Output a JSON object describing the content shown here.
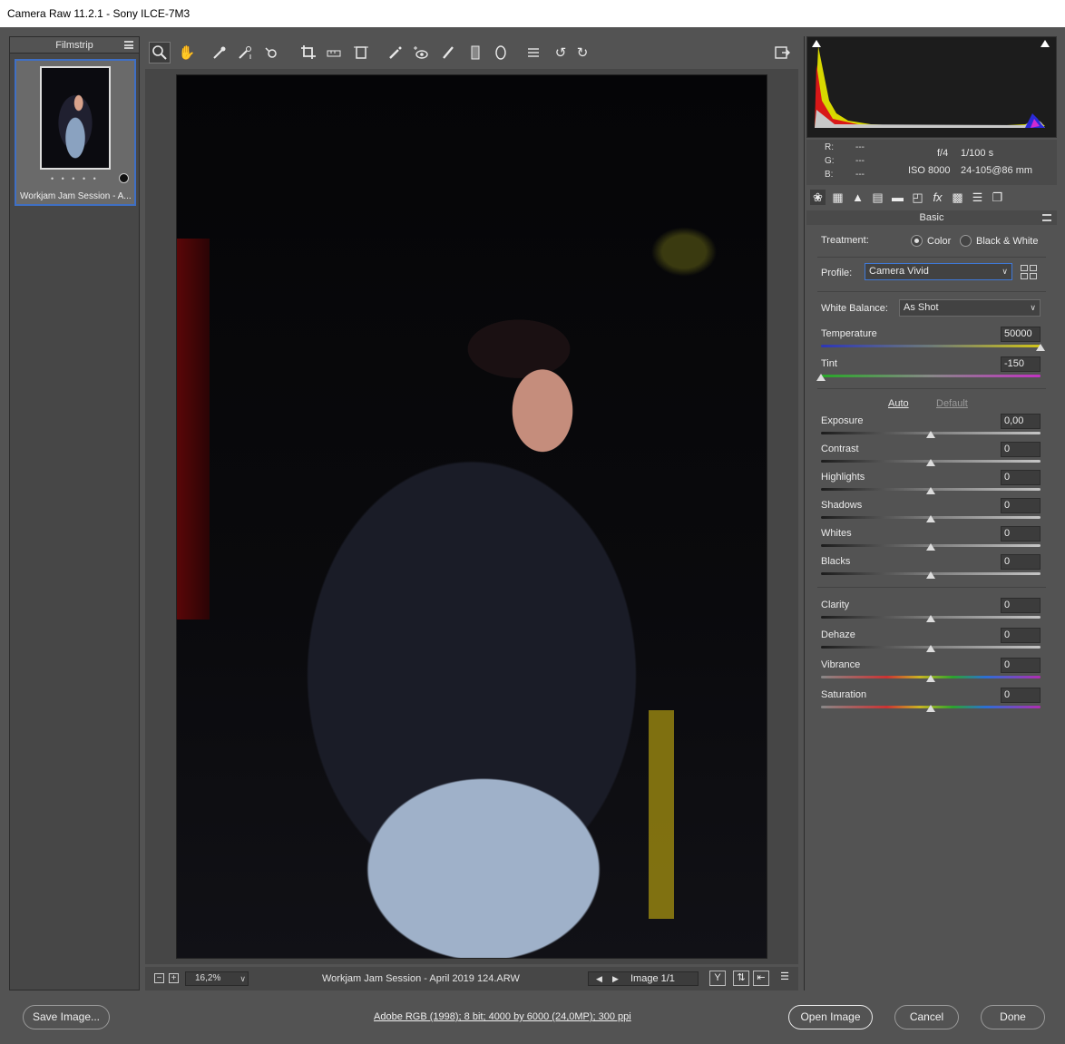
{
  "window": {
    "title": "Camera Raw 11.2.1  -  Sony ILCE-7M3"
  },
  "filmstrip": {
    "title": "Filmstrip",
    "thumbnail_caption": "Workjam Jam Session - A...",
    "rating_dots": "• • • • •"
  },
  "toolbar": {
    "tools": [
      "zoom-tool",
      "hand-tool",
      "white-balance-tool",
      "color-sampler-tool",
      "targeted-adjustment-tool",
      "crop-tool",
      "straighten-tool",
      "transform-tool",
      "spot-removal-tool",
      "red-eye-tool",
      "adjustment-brush",
      "graduated-filter",
      "radial-filter",
      "preferences",
      "rotate-left",
      "rotate-right",
      "toggle-fullscreen"
    ]
  },
  "statusbar": {
    "zoom": "16,2%",
    "filename": "Workjam Jam Session - April 2019 124.ARW",
    "image_count": "Image 1/1",
    "before_after_label": "Y"
  },
  "readout": {
    "r_label": "R:",
    "g_label": "G:",
    "b_label": "B:",
    "r_value": "---",
    "g_value": "---",
    "b_value": "---",
    "aperture": "f/4",
    "shutter": "1/100 s",
    "iso": "ISO 8000",
    "lens": "24-105@86 mm"
  },
  "panel": {
    "section_title": "Basic",
    "treatment_label": "Treatment:",
    "treatment_color": "Color",
    "treatment_bw": "Black & White",
    "profile_label": "Profile:",
    "profile_value": "Camera Vivid",
    "wb_label": "White Balance:",
    "wb_value": "As Shot",
    "auto": "Auto",
    "default": "Default",
    "sliders": {
      "temperature": {
        "label": "Temperature",
        "value": "50000",
        "level": 1.0
      },
      "tint": {
        "label": "Tint",
        "value": "-150",
        "level": 0.0
      },
      "exposure": {
        "label": "Exposure",
        "value": "0,00",
        "level": 0.5
      },
      "contrast": {
        "label": "Contrast",
        "value": "0",
        "level": 0.5
      },
      "highlights": {
        "label": "Highlights",
        "value": "0",
        "level": 0.5
      },
      "shadows": {
        "label": "Shadows",
        "value": "0",
        "level": 0.5
      },
      "whites": {
        "label": "Whites",
        "value": "0",
        "level": 0.5
      },
      "blacks": {
        "label": "Blacks",
        "value": "0",
        "level": 0.5
      },
      "clarity": {
        "label": "Clarity",
        "value": "0",
        "level": 0.5
      },
      "dehaze": {
        "label": "Dehaze",
        "value": "0",
        "level": 0.5
      },
      "vibrance": {
        "label": "Vibrance",
        "value": "0",
        "level": 0.5
      },
      "saturation": {
        "label": "Saturation",
        "value": "0",
        "level": 0.5
      }
    }
  },
  "bottom": {
    "save_image": "Save Image...",
    "workflow": "Adobe RGB (1998); 8 bit; 4000 by 6000 (24,0MP); 300 ppi",
    "open_image": "Open Image",
    "cancel": "Cancel",
    "done": "Done"
  },
  "colors": {
    "accent": "#3f6fc4",
    "focus": "#3f78d6",
    "background": "#535353"
  }
}
